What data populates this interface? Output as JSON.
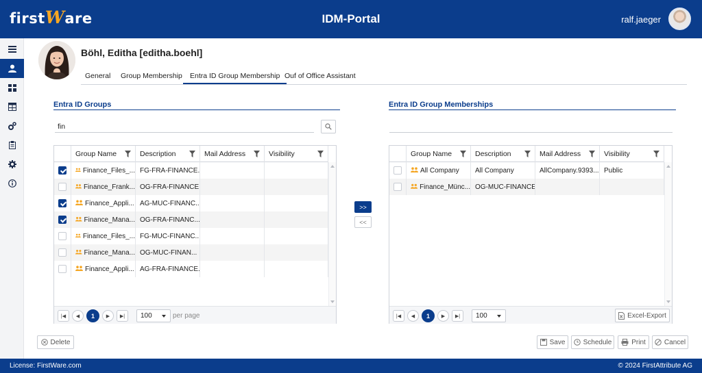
{
  "header": {
    "logo_first": "first",
    "logo_w": "W",
    "logo_are": "are",
    "title": "IDM-Portal",
    "username": "ralf.jaeger"
  },
  "sidebar": {
    "items": [
      {
        "icon": "menu-icon",
        "glyph": "≡",
        "active": false
      },
      {
        "icon": "user-icon",
        "glyph": "●",
        "active": true
      },
      {
        "icon": "dashboard-icon",
        "glyph": "▦",
        "active": false
      },
      {
        "icon": "table-icon",
        "glyph": "⊞",
        "active": false
      },
      {
        "icon": "gears-icon",
        "glyph": "⚙",
        "active": false
      },
      {
        "icon": "clipboard-icon",
        "glyph": "▤",
        "active": false
      },
      {
        "icon": "settings-icon",
        "glyph": "✲",
        "active": false
      },
      {
        "icon": "info-icon",
        "glyph": "ⓘ",
        "active": false
      }
    ]
  },
  "user": {
    "name": "Böhl, Editha [editha.boehl]"
  },
  "tabs": [
    {
      "label": "General",
      "active": false
    },
    {
      "label": "Group Membership",
      "active": false
    },
    {
      "label": "Entra ID Group Membership",
      "active": true
    },
    {
      "label": "Ouf of Office Assistant",
      "active": false
    }
  ],
  "left_panel": {
    "title": "Entra ID Groups",
    "search_value": "fin",
    "columns": [
      "Group Name",
      "Description",
      "Mail Address",
      "Visibility"
    ],
    "rows": [
      {
        "checked": true,
        "name": "Finance_Files_...",
        "description": "FG-FRA-FINANCE...",
        "mail": "",
        "visibility": ""
      },
      {
        "checked": false,
        "name": "Finance_Frank...",
        "description": "OG-FRA-FINANCE",
        "mail": "",
        "visibility": ""
      },
      {
        "checked": true,
        "name": "Finance_Appli...",
        "description": "AG-MUC-FINANC...",
        "mail": "",
        "visibility": ""
      },
      {
        "checked": true,
        "name": "Finance_Mana...",
        "description": "OG-FRA-FINANC...",
        "mail": "",
        "visibility": ""
      },
      {
        "checked": false,
        "name": "Finance_Files_...",
        "description": "FG-MUC-FINANC...",
        "mail": "",
        "visibility": ""
      },
      {
        "checked": false,
        "name": "Finance_Mana...",
        "description": "OG-MUC-FINAN...",
        "mail": "",
        "visibility": ""
      },
      {
        "checked": false,
        "name": "Finance_Appli...",
        "description": "AG-FRA-FINANCE...",
        "mail": "",
        "visibility": ""
      }
    ],
    "pager": {
      "current_page": "1",
      "page_size": "100",
      "per_page_label": "per page"
    }
  },
  "right_panel": {
    "title": "Entra ID Group Memberships",
    "search_value": "",
    "columns": [
      "Group Name",
      "Description",
      "Mail Address",
      "Visibility"
    ],
    "rows": [
      {
        "checked": false,
        "name": "All Company",
        "description": "All Company",
        "mail": "AllCompany.9393...",
        "visibility": "Public"
      },
      {
        "checked": false,
        "name": "Finance_Münc...",
        "description": "OG-MUC-FINANCE",
        "mail": "",
        "visibility": ""
      }
    ],
    "pager": {
      "current_page": "1",
      "page_size": "100"
    },
    "excel_export_label": "Excel-Export"
  },
  "move": {
    "add_label": ">>",
    "remove_label": "<<"
  },
  "actions": {
    "delete_label": "Delete",
    "save_label": "Save",
    "schedule_label": "Schedule",
    "print_label": "Print",
    "cancel_label": "Cancel"
  },
  "footer": {
    "license": "License: FirstWare.com",
    "copyright": "© 2024 FirstAttribute AG"
  },
  "colors": {
    "brand": "#0b3d8c",
    "group_icon": "#f5a623"
  }
}
